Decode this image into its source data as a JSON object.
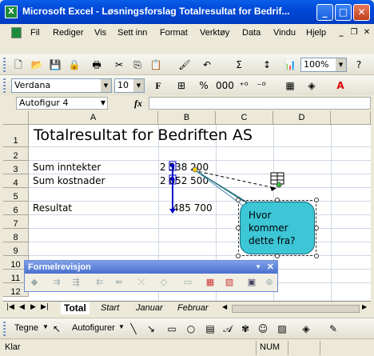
{
  "window": {
    "title": "Microsoft Excel - Løsningsforslag Totalresultat for Bedrif...",
    "app_icon": "excel-icon"
  },
  "menu": [
    "Fil",
    "Rediger",
    "Vis",
    "Sett inn",
    "Format",
    "Verktøy",
    "Data",
    "Vindu",
    "Hjelp"
  ],
  "standard_toolbar": {
    "zoom": "100%"
  },
  "format_toolbar": {
    "font": "Verdana",
    "size": "10",
    "bold": "F"
  },
  "formula_bar": {
    "name_box": "Autofigur 4",
    "fx": "fx",
    "formula": ""
  },
  "columns": [
    "A",
    "B",
    "C",
    "D"
  ],
  "rows": [
    "1",
    "2",
    "3",
    "4",
    "5",
    "6",
    "7",
    "8",
    "9",
    "10",
    "11",
    "12"
  ],
  "cells": {
    "a1": "Totalresultat for Bedriften AS",
    "a3": "Sum inntekter",
    "b3": "2 538 200",
    "a4": "Sum kostnader",
    "b4": "2 052 500",
    "a6": "Resultat",
    "b6": "485 700"
  },
  "callout": {
    "lines": [
      "Hvor",
      "kommer",
      "dette fra?"
    ],
    "color": "#3cc6d6"
  },
  "formelrevisjon": {
    "title": "Formelrevisjon"
  },
  "sheet_tabs": {
    "active": "Total",
    "others": [
      "Start",
      "Januar",
      "Februar"
    ]
  },
  "drawing_toolbar": {
    "tegne": "Tegne",
    "autofigurer": "Autofigurer"
  },
  "status": {
    "left": "Klar",
    "num": "NUM"
  }
}
